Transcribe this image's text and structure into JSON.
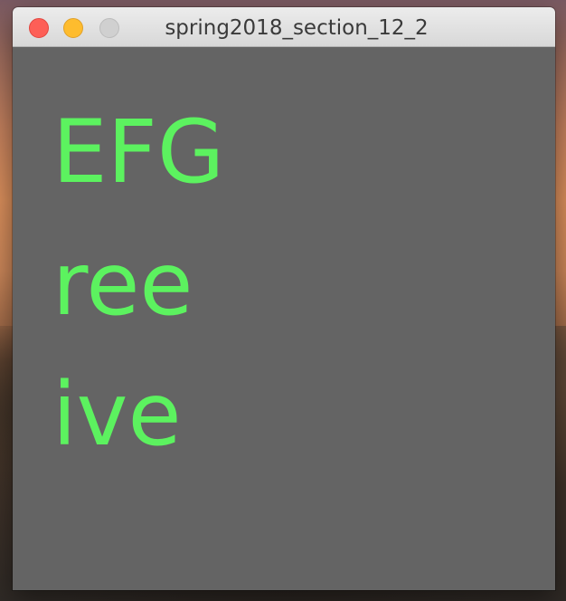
{
  "window": {
    "title": "spring2018_section_12_2"
  },
  "canvas": {
    "background_color": "#646464",
    "text_color": "#5cf25f",
    "lines": [
      "EFG",
      "ree",
      "ive"
    ]
  },
  "traffic_lights": {
    "close_color": "#fd5f57",
    "minimize_color": "#febc2e",
    "zoom_color": "#d0d0d0"
  }
}
